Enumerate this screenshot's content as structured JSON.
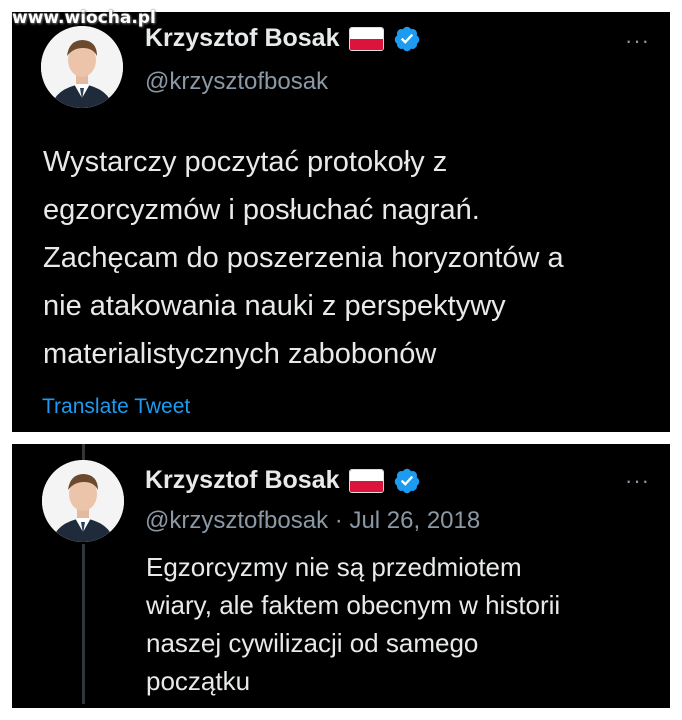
{
  "watermark": "www.wiocha.pl",
  "tweets": [
    {
      "author_name": "Krzysztof Bosak",
      "author_handle": "@krzysztofbosak",
      "text_lines": [
        "Wystarczy poczytać protokoły z",
        "egzorcyzmów i posłuchać nagrań.",
        "Zachęcam do poszerzenia horyzontów a",
        "nie atakowania nauki z perspektywy",
        "materialistycznych zabobonów"
      ],
      "translate_label": "Translate Tweet",
      "more": "···"
    },
    {
      "author_name": "Krzysztof Bosak",
      "author_handle": "@krzysztofbosak",
      "separator": "·",
      "date": "Jul 26, 2018",
      "text_lines": [
        "Egzorcyzmy nie są przedmiotem",
        "wiary, ale faktem obecnym w historii",
        "naszej cywilizacji od samego",
        "początku"
      ],
      "more": "···"
    }
  ],
  "colors": {
    "background": "#000000",
    "text": "#e7e9ea",
    "secondary": "#8b98a5",
    "link": "#1d9bf0",
    "verified": "#1d9bf0",
    "flag_red": "#dc143c"
  },
  "icons": [
    "flag-poland-icon",
    "verified-badge-icon",
    "more-options-icon",
    "avatar"
  ]
}
